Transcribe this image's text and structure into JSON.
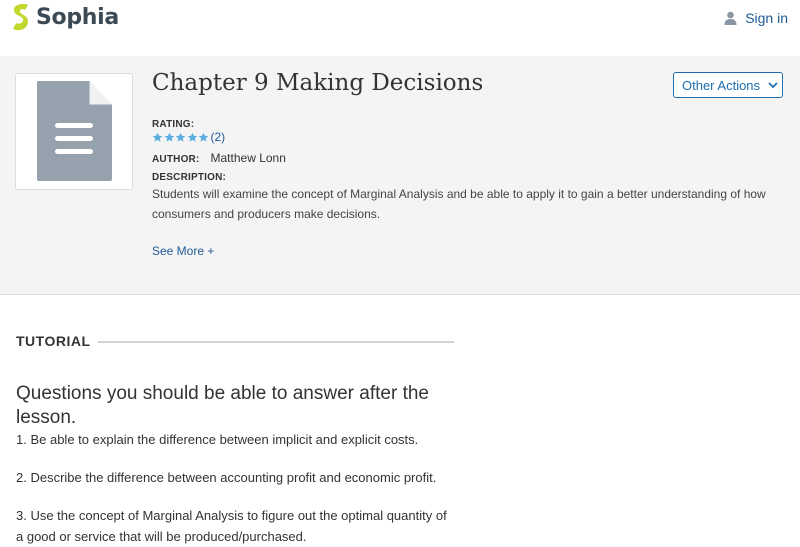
{
  "header": {
    "logo_text": "Sophia",
    "signin_label": "Sign in"
  },
  "hero": {
    "title": "Chapter 9 Making Decisions",
    "other_actions_label": "Other Actions",
    "rating_label": "RATING:",
    "rating_stars": 5,
    "rating_count": "(2)",
    "author_label": "AUTHOR:",
    "author_name": "Matthew Lonn",
    "description_label": "DESCRIPTION:",
    "description": "Students will examine the concept of Marginal Analysis and be able to apply it to gain a better understanding of how consumers and producers make decisions.",
    "see_more": "See More +"
  },
  "tutorial": {
    "label": "TUTORIAL",
    "heading": "Questions you should be able to answer after the lesson.",
    "questions": [
      "1. Be able to explain the difference between implicit and explicit costs.",
      "2. Describe the difference between accounting profit and economic profit.",
      "3. Use the concept of Marginal Analysis to figure out the optimal quantity of a good or service that will be produced/purchased."
    ]
  },
  "colors": {
    "brand_green": "#c3d82e",
    "link_blue": "#1f5a96",
    "star_blue": "#5aaee0",
    "hero_bg": "#f4f4f4"
  },
  "icons": {
    "logo": "sophia-logo-icon",
    "signin": "person-icon",
    "thumb": "document-icon",
    "dropdown": "chevron-down-icon",
    "star": "star-icon"
  }
}
